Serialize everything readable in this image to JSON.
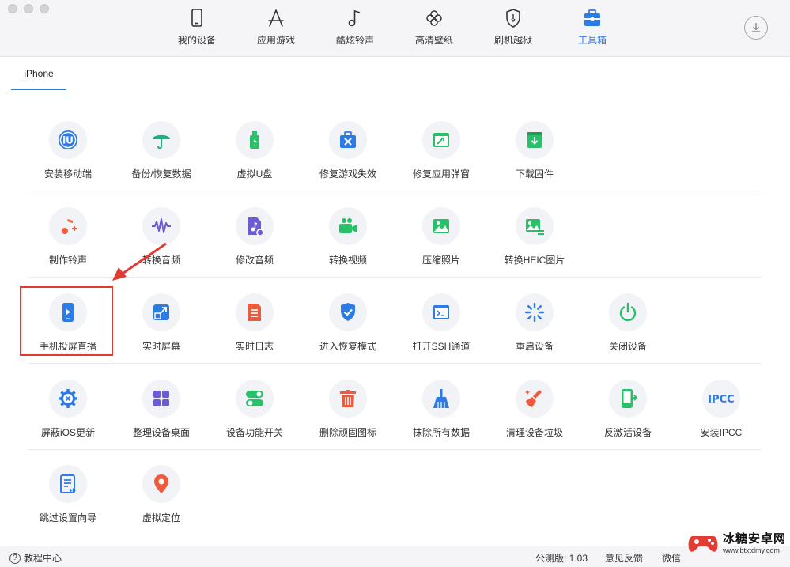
{
  "nav": {
    "items": [
      {
        "label": "我的设备",
        "icon": "phone-icon"
      },
      {
        "label": "应用游戏",
        "icon": "app-store-icon"
      },
      {
        "label": "酷炫铃声",
        "icon": "music-note-icon"
      },
      {
        "label": "高清壁纸",
        "icon": "flower-icon"
      },
      {
        "label": "刷机越狱",
        "icon": "shield-icon"
      },
      {
        "label": "工具箱",
        "icon": "toolbox-icon"
      }
    ],
    "active": "工具箱",
    "accent_color": "#2d7be5"
  },
  "tabs": [
    {
      "label": "iPhone"
    }
  ],
  "tools": {
    "row1": [
      {
        "label": "安装移动端",
        "icon": "iu-logo-icon",
        "color": "#2d7be5"
      },
      {
        "label": "备份/恢复数据",
        "icon": "umbrella-icon",
        "color": "#19b37d"
      },
      {
        "label": "虚拟U盘",
        "icon": "usb-drive-icon",
        "color": "#29c06a"
      },
      {
        "label": "修复游戏失效",
        "icon": "toolbox-wrench-icon",
        "color": "#2d7be5"
      },
      {
        "label": "修复应用弹窗",
        "icon": "window-wrench-icon",
        "color": "#29c06a"
      },
      {
        "label": "下载固件",
        "icon": "download-box-icon",
        "color": "#29c06a"
      }
    ],
    "row2": [
      {
        "label": "制作铃声",
        "icon": "ringtone-plus-icon",
        "color": "#f05a3c"
      },
      {
        "label": "转换音频",
        "icon": "waveform-icon",
        "color": "#6b5bd6"
      },
      {
        "label": "修改音频",
        "icon": "audio-file-gear-icon",
        "color": "#6b5bd6"
      },
      {
        "label": "转换视频",
        "icon": "video-camera-icon",
        "color": "#29c06a"
      },
      {
        "label": "压缩照片",
        "icon": "photo-icon",
        "color": "#29c06a"
      },
      {
        "label": "转换HEIC图片",
        "icon": "photo-convert-icon",
        "color": "#29c06a"
      }
    ],
    "row3": [
      {
        "label": "手机投屏直播",
        "icon": "phone-play-icon",
        "color": "#2d7be5"
      },
      {
        "label": "实时屏幕",
        "icon": "screen-arrow-icon",
        "color": "#2d7be5"
      },
      {
        "label": "实时日志",
        "icon": "log-document-icon",
        "color": "#f05a3c"
      },
      {
        "label": "进入恢复模式",
        "icon": "shield-check-icon",
        "color": "#2d7be5"
      },
      {
        "label": "打开SSH通道",
        "icon": "terminal-window-icon",
        "color": "#2d7be5"
      },
      {
        "label": "重启设备",
        "icon": "spinner-icon",
        "color": "#2d7be5"
      },
      {
        "label": "关闭设备",
        "icon": "power-icon",
        "color": "#29c06a"
      }
    ],
    "row4": [
      {
        "label": "屏蔽iOS更新",
        "icon": "gear-x-icon",
        "color": "#2d7be5"
      },
      {
        "label": "整理设备桌面",
        "icon": "grid-apps-icon",
        "color": "#6b5bd6"
      },
      {
        "label": "设备功能开关",
        "icon": "toggle-icon",
        "color": "#29c06a"
      },
      {
        "label": "删除顽固图标",
        "icon": "trash-icon",
        "color": "#f05a3c"
      },
      {
        "label": "抹除所有数据",
        "icon": "broom-icon",
        "color": "#2d7be5"
      },
      {
        "label": "清理设备垃圾",
        "icon": "brush-clean-icon",
        "color": "#f05a3c"
      },
      {
        "label": "反激活设备",
        "icon": "phone-deactivate-icon",
        "color": "#29c06a"
      },
      {
        "label": "安装IPCC",
        "icon": "ipcc-text-icon",
        "icon_text": "IPCC",
        "color": "#2d7be5"
      }
    ],
    "row5": [
      {
        "label": "跳过设置向导",
        "icon": "skip-list-icon",
        "color": "#2d7be5"
      },
      {
        "label": "虚拟定位",
        "icon": "location-pin-icon",
        "color": "#f05a3c"
      }
    ]
  },
  "statusbar": {
    "help_label": "教程中心",
    "version": "公测版: 1.03",
    "feedback": "意见反馈",
    "wechat": "微信"
  },
  "watermark": {
    "main": "冰糖安卓网",
    "sub": "www.btxtdmy.com"
  }
}
